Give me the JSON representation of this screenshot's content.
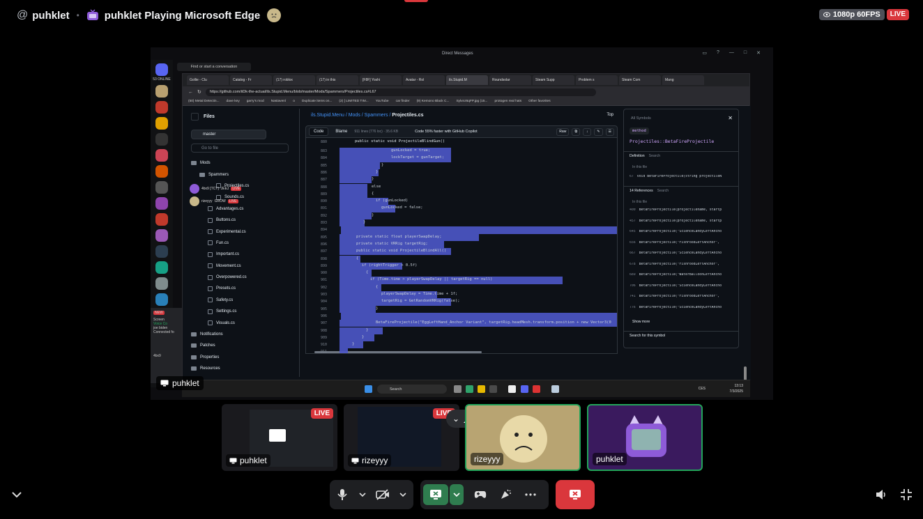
{
  "header": {
    "at_symbol": "@",
    "channel_name": "puhklet",
    "separator": "•",
    "activity": "puhklet Playing Microsoft Edge",
    "quality": "1080p 60FPS",
    "live_badge": "LIVE"
  },
  "stream": {
    "discord": {
      "dm_title": "Direct Messages",
      "find_conversation": "Find or start a conversation",
      "online_count": "53 ONLINE",
      "voice_status": "Voice Co",
      "voice_channel": "joe biden",
      "voice_connected": "Connected fo",
      "screen_label": "Screen",
      "new_badge": "NEW",
      "user_label": "4bx9"
    },
    "browser": {
      "tabs": [
        "Gollie - Clu",
        "Catalog - Fr",
        "(17) roblox",
        "(17) in this",
        "[F8F] Yoshi",
        "Avatar - Rol",
        "ils.Stupid.M",
        "Roundsolar",
        "Steam Supp",
        "Problem s",
        "Steam Com",
        "Mang"
      ],
      "url": "https://github.com/iiDk-the-actual/ils.Stupid.Menu/blob/master/Mods/Spammers/Projectiles.cs#L67",
      "bookmarks": [
        "(50) Metal Detectin...",
        "dave key",
        "garry's mod",
        "Nastavení",
        "o",
        "Duplicate items on...",
        "(2) [ LIMITED TIM...",
        "YouTube",
        "car finder",
        "(9) Kemono Black C...",
        "Sylvnz6qFP.jpg (15...",
        "protogen real hats",
        "Other favorites"
      ]
    },
    "github": {
      "files_title": "Files",
      "branch": "master",
      "goto_placeholder": "Go to file",
      "goto_shortcut": "t",
      "tree": [
        {
          "label": "Mods",
          "kind": "folder",
          "depth": 0
        },
        {
          "label": "Spammers",
          "kind": "folder",
          "depth": 1
        },
        {
          "label": "Projectiles.cs",
          "kind": "file",
          "depth": 2
        },
        {
          "label": "Sounds.cs",
          "kind": "file",
          "depth": 2
        },
        {
          "label": "Advantages.cs",
          "kind": "file",
          "depth": 1
        },
        {
          "label": "Buttons.cs",
          "kind": "file",
          "depth": 1
        },
        {
          "label": "Experimental.cs",
          "kind": "file",
          "depth": 1
        },
        {
          "label": "Fun.cs",
          "kind": "file",
          "depth": 1
        },
        {
          "label": "Important.cs",
          "kind": "file",
          "depth": 1
        },
        {
          "label": "Movement.cs",
          "kind": "file",
          "depth": 1
        },
        {
          "label": "Overpowered.cs",
          "kind": "file",
          "depth": 1
        },
        {
          "label": "Presets.cs",
          "kind": "file",
          "depth": 1
        },
        {
          "label": "Safety.cs",
          "kind": "file",
          "depth": 1
        },
        {
          "label": "Settings.cs",
          "kind": "file",
          "depth": 1
        },
        {
          "label": "Visuals.cs",
          "kind": "file",
          "depth": 1
        },
        {
          "label": "Notifications",
          "kind": "folder",
          "depth": 0
        },
        {
          "label": "Patches",
          "kind": "folder",
          "depth": 0
        },
        {
          "label": "Properties",
          "kind": "folder",
          "depth": 0
        },
        {
          "label": "Resources",
          "kind": "folder",
          "depth": 0
        }
      ],
      "breadcrumb_repo": "ils.Stupid.Menu",
      "breadcrumb_mid": "/ Mods / Spammers /",
      "breadcrumb_file": "Projectiles.cs",
      "top_link": "Top",
      "code_tab": "Code",
      "blame_tab": "Blame",
      "file_meta": "911 lines (776 loc) · 35.6 KB",
      "copilot": "Code 55% faster with GitHub Copilot",
      "raw": "Raw",
      "first_line_num": "880",
      "first_line": "public static void ProjectileBlindGun()",
      "line_numbers": [
        "883",
        "884",
        "885",
        "886",
        "887",
        "888",
        "889",
        "890",
        "891",
        "892",
        "893",
        "894",
        "895",
        "896",
        "897",
        "898",
        "899",
        "900",
        "901",
        "902",
        "903",
        "904",
        "905",
        "906",
        "907",
        "908",
        "909",
        "910",
        "911"
      ],
      "code_lines": [
        "gunLocked = true;",
        "lockTarget = gunTarget;",
        "}",
        "}",
        "}",
        "else",
        "{",
        "if (gunLocked)",
        "gunLocked = false;",
        "}",
        "}",
        "",
        "private static float playerSwapDelay;",
        "private static VRRig targetRig;",
        "public static void ProjectileBlindAll()",
        "{",
        "if (rightTrigger > 0.5f)",
        "{",
        "if (Time.time > playerSwapDelay || targetRig == null)",
        "{",
        "playerSwapDelay = Time.time + 1f;",
        "targetRig = GetRandomVRRig(false);",
        "}",
        "",
        "BetaFireProjectile(\"EggLeftHand_Anchor Variant\", targetRig.headMesh.transform.position + new Vector3(0",
        "}",
        "}",
        "}",
        ""
      ],
      "symbols": {
        "all_symbols": "All Symbols",
        "kind": "method",
        "name": "Projectiles::BetaFireProjectile",
        "definition": "Definition",
        "search": "Search",
        "in_this_file": "In this file",
        "def_line_num": "67",
        "def_line": "void BetaFireProjectile(string projectileN",
        "references": "14 References",
        "refs": [
          {
            "num": "400",
            "text": "BetaFireProjectile(projectilename, startp"
          },
          {
            "num": "457",
            "text": "BetaFireProjectile(projectilename, startp"
          },
          {
            "num": "645",
            "text": "BetaFireProjectile(\"ScienceCandyLeftAncho"
          },
          {
            "num": "656",
            "text": "BetaFireProjectile(\"FishFoodLeftAnchor\","
          },
          {
            "num": "667",
            "text": "BetaFireProjectile(\"ScienceCandyLeftAncho"
          },
          {
            "num": "678",
            "text": "BetaFireProjectile(\"FishFoodLeftAnchor\","
          },
          {
            "num": "689",
            "text": "BetaFireProjectile(\"WaterBalloonLeftAncho"
          },
          {
            "num": "706",
            "text": "BetaFireProjectile(\"ScienceCandyLeftAncho"
          },
          {
            "num": "741",
            "text": "BetaFireProjectile(\"FishFoodLeftAnchor\","
          },
          {
            "num": "776",
            "text": "BetaFireProjectile(\"ScienceCandyLeftAncho"
          }
        ],
        "show_more": "Show more",
        "search_symbol": "Search for this symbol"
      }
    },
    "overlay_users": [
      {
        "name": "4bx9 [TCT]",
        "tag": "JEEJ",
        "live": "LIVE"
      },
      {
        "name": "rizeyyy",
        "tag": "GROW",
        "live": "LIVE"
      }
    ],
    "taskbar": {
      "search": "Search",
      "lang": "CES",
      "time": "13:13",
      "date": "7/3/2025"
    },
    "stream_owner": "puhklet"
  },
  "participants": [
    {
      "name": "puhklet",
      "live": "LIVE",
      "kind": "screen"
    },
    {
      "name": "rizeyyy",
      "live": "LIVE",
      "kind": "screen"
    },
    {
      "name": "rizeyyy",
      "kind": "camera"
    },
    {
      "name": "puhklet",
      "kind": "camera"
    }
  ],
  "colors": {
    "live": "#da373c",
    "speaking": "#23a55a",
    "selection": "#4c58c9",
    "leave": "#da373c"
  }
}
